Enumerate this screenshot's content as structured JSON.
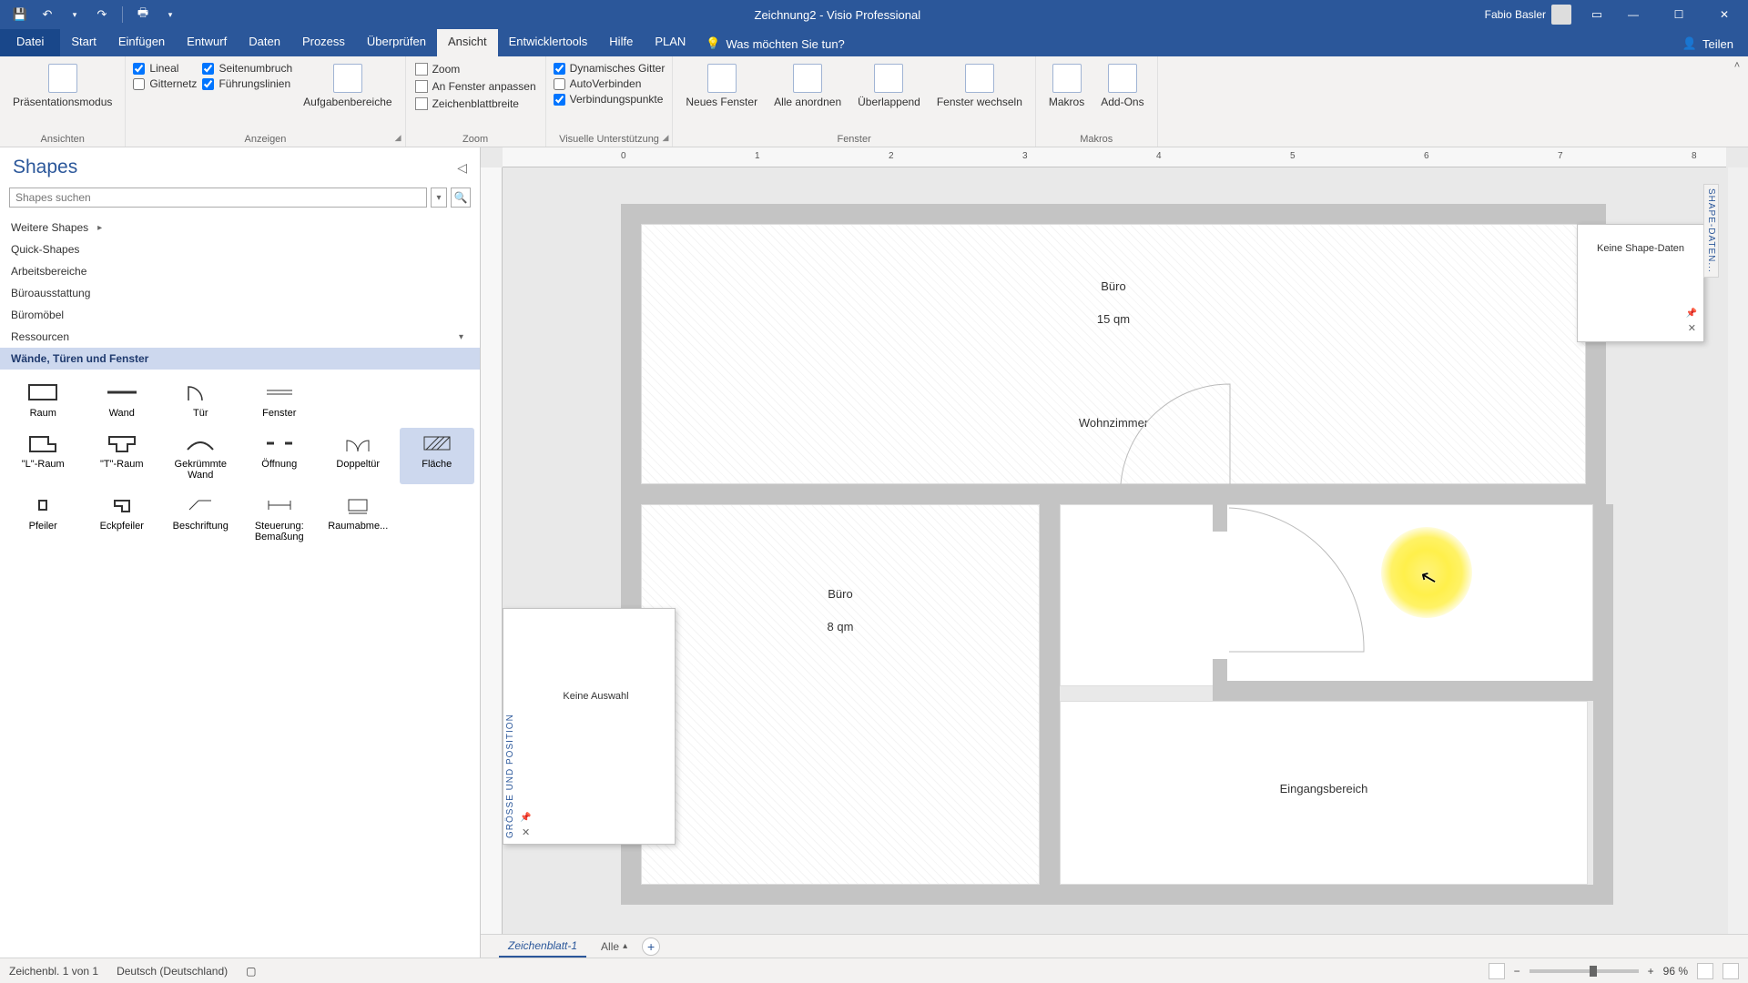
{
  "title": "Zeichnung2 - Visio Professional",
  "user": "Fabio Basler",
  "tabs": {
    "file": "Datei",
    "items": [
      "Start",
      "Einfügen",
      "Entwurf",
      "Daten",
      "Prozess",
      "Überprüfen",
      "Ansicht",
      "Entwicklertools",
      "Hilfe",
      "PLAN"
    ],
    "active": "Ansicht",
    "tellme": "Was möchten Sie tun?",
    "share": "Teilen"
  },
  "ribbon": {
    "views_group": "Ansichten",
    "presentation": "Präsentationsmodus",
    "show_group": "Anzeigen",
    "chk_lineal": "Lineal",
    "chk_seitenumbruch": "Seitenumbruch",
    "chk_gitternetz": "Gitternetz",
    "chk_fuhrungslinien": "Führungslinien",
    "aufgaben": "Aufgabenbereiche",
    "zoom_group": "Zoom",
    "zoom": "Zoom",
    "an_fenster": "An Fenster anpassen",
    "zeichenblatt": "Zeichenblattbreite",
    "visuelle_group": "Visuelle Unterstützung",
    "dyn_gitter": "Dynamisches Gitter",
    "autoverbinden": "AutoVerbinden",
    "verbindungspunkte": "Verbindungspunkte",
    "fenster_group": "Fenster",
    "neues_fenster": "Neues Fenster",
    "alle_anordnen": "Alle anordnen",
    "uberlappend": "Überlappend",
    "fenster_wechseln": "Fenster wechseln",
    "makros_group": "Makros",
    "makros": "Makros",
    "addons": "Add-Ons"
  },
  "shapes_panel": {
    "title": "Shapes",
    "search_placeholder": "Shapes suchen",
    "categories": {
      "weitere": "Weitere Shapes",
      "quick": "Quick-Shapes",
      "arbeitsbereiche": "Arbeitsbereiche",
      "buroausstattung": "Büroausstattung",
      "buromobel": "Büromöbel",
      "ressourcen": "Ressourcen",
      "wande": "Wände, Türen und Fenster"
    },
    "stencil": {
      "raum": "Raum",
      "wand": "Wand",
      "tur": "Tür",
      "fenster": "Fenster",
      "lraum": "\"L\"-Raum",
      "traum": "\"T\"-Raum",
      "gekrummte": "Gekrümmte Wand",
      "offnung": "Öffnung",
      "doppeltur": "Doppeltür",
      "flache": "Fläche",
      "pfeiler": "Pfeiler",
      "eckpfeiler": "Eckpfeiler",
      "beschriftung": "Beschriftung",
      "steuerung": "Steuerung: Bemaßung",
      "raumabme": "Raumabme..."
    }
  },
  "canvas": {
    "buro1_name": "Büro",
    "buro1_area": "15 qm",
    "wohnzimmer": "Wohnzimmer",
    "buro2_name": "Büro",
    "buro2_area": "8 qm",
    "eingang": "Eingangsbereich"
  },
  "float_size_pos": {
    "title": "GRÖSSE UND POSITION",
    "no_selection": "Keine Auswahl"
  },
  "shape_data": {
    "tab": "SHAPE-DATEN...",
    "none": "Keine Shape-Daten"
  },
  "sheet_tabs": {
    "sheet1": "Zeichenblatt-1",
    "all": "Alle"
  },
  "statusbar": {
    "page": "Zeichenbl. 1 von 1",
    "lang": "Deutsch (Deutschland)",
    "zoom": "96 %"
  },
  "ruler_h": [
    "0",
    "1",
    "2",
    "3",
    "4",
    "5",
    "6",
    "7",
    "8"
  ]
}
